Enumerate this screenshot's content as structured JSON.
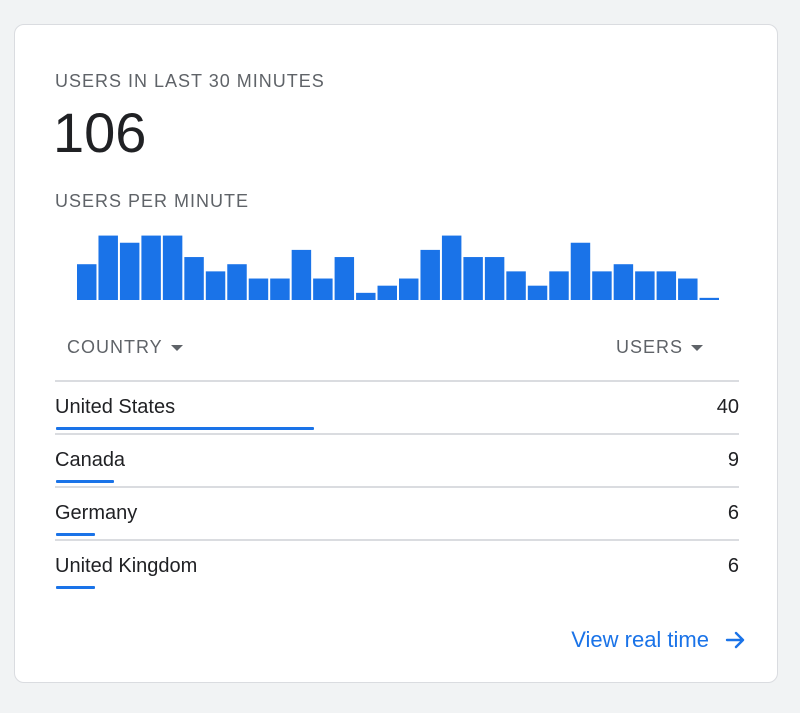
{
  "card": {
    "users_label": "USERS IN LAST 30 MINUTES",
    "users_count": "106",
    "per_minute_label": "USERS PER MINUTE"
  },
  "chart_data": {
    "type": "bar",
    "color": "#1a73e8",
    "values": [
      5,
      9,
      8,
      9,
      9,
      6,
      4,
      5,
      3,
      3,
      7,
      3,
      6,
      1,
      2,
      3,
      7,
      9,
      6,
      6,
      4,
      2,
      4,
      8,
      4,
      5,
      4,
      4,
      3,
      0.3
    ],
    "ylim": [
      0,
      9.5
    ]
  },
  "table": {
    "col_country": "COUNTRY",
    "col_users": "USERS",
    "max_users": 40,
    "rows": [
      {
        "name": "United States",
        "value": "40",
        "users": 40
      },
      {
        "name": "Canada",
        "value": "9",
        "users": 9
      },
      {
        "name": "Germany",
        "value": "6",
        "users": 6
      },
      {
        "name": "United Kingdom",
        "value": "6",
        "users": 6
      }
    ]
  },
  "footer": {
    "view_link": "View real time",
    "link_icon": "arrow-right-icon"
  },
  "colors": {
    "accent": "#1a73e8",
    "text": "#202124",
    "muted": "#5f6368",
    "divider": "#dadce0"
  }
}
